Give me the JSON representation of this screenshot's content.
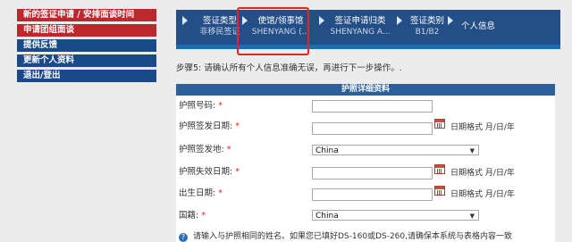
{
  "sidebar": {
    "items": [
      {
        "label": "新的签证申请 / 安排面谈时间"
      },
      {
        "label": "申请团组面谈"
      },
      {
        "label": "提供反馈"
      },
      {
        "label": "更新个人资料"
      },
      {
        "label": "退出/登出"
      }
    ]
  },
  "steps": [
    {
      "title": "签证类型",
      "sub": "非移民签证"
    },
    {
      "title": "使馆/领事馆",
      "sub": "SHENYANG (..."
    },
    {
      "title": "签证申请归类",
      "sub": "SHENYANG A..."
    },
    {
      "title": "签证类别",
      "sub": "B1/B2"
    },
    {
      "title": "个人信息",
      "sub": ""
    }
  ],
  "instruction": "步骤5: 请确认所有个人信息准确无误，再进行下一步操作。.",
  "section": {
    "title": "护照详细资料"
  },
  "form": {
    "passport_number": {
      "label": "护照号码:",
      "value": ""
    },
    "issue_date": {
      "label": "护照签发日期:",
      "value": "",
      "format": "日期格式 月/日/年"
    },
    "issue_country": {
      "label": "护照签发地:",
      "value": "China"
    },
    "expiry_date": {
      "label": "护照失效日期:",
      "value": "",
      "format": "日期格式 月/日/年"
    },
    "birth_date": {
      "label": "出生日期:",
      "value": "",
      "format": "日期格式 月/日/年"
    },
    "nationality": {
      "label": "国籍:",
      "value": "China"
    },
    "required_mark": "*",
    "note": "请输入与护照相同的姓名。如果您已填好DS-160或DS-260,请确保本系统与表格内容一致"
  },
  "icons": {
    "note_icon": "question-icon",
    "calendar_icon": "calendar-icon",
    "dropdown_icon": "chevron-down-icon"
  },
  "colors": {
    "sidebar_red": "#c0272d",
    "sidebar_blue": "#1a4a8a",
    "step_bar": "#244e86",
    "highlight": "#e42424"
  }
}
